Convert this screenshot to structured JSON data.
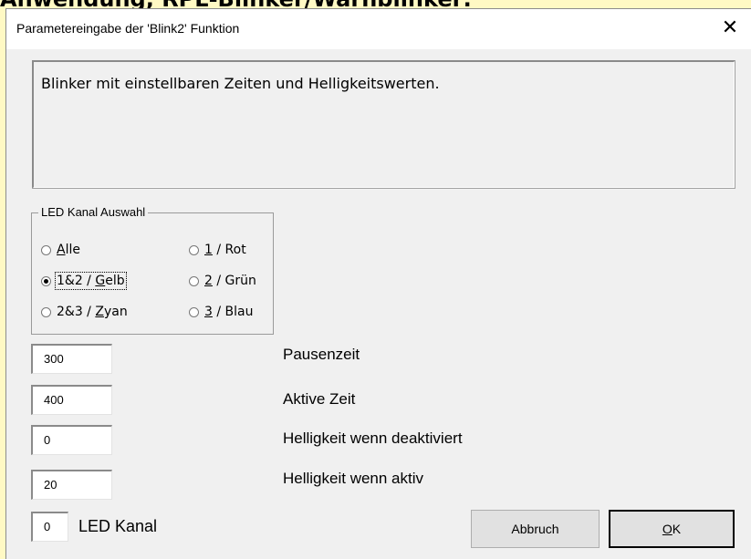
{
  "background_heading": "Anwendung, RPL-Blinker/Warnblinker:",
  "dialog": {
    "title": "Parametereingabe der 'Blink2' Funktion",
    "close_glyph": "✕",
    "description": "Blinker mit einstellbaren Zeiten und Helligkeitswerten."
  },
  "led_group": {
    "label": "LED Kanal Auswahl",
    "options": [
      {
        "mnemonic": "A",
        "rest": "lle",
        "selected": false
      },
      {
        "prefix": "1&2 / ",
        "mnemonic": "G",
        "rest": "elb",
        "selected": true
      },
      {
        "prefix": "2&3 / ",
        "mnemonic": "Z",
        "rest": "yan",
        "selected": false
      },
      {
        "mnemonic": "1",
        "rest": " / Rot",
        "selected": false
      },
      {
        "mnemonic": "2",
        "rest": " / Grün",
        "selected": false
      },
      {
        "mnemonic": "3",
        "rest": " / Blau",
        "selected": false
      }
    ]
  },
  "params": [
    {
      "value": "300",
      "label": "Pausenzeit"
    },
    {
      "value": "400",
      "label": "Aktive Zeit"
    },
    {
      "value": "0",
      "label": "Helligkeit wenn deaktiviert"
    },
    {
      "value": "20",
      "label": "Helligkeit wenn aktiv"
    }
  ],
  "led_kanal": {
    "value": "0",
    "label": "LED Kanal"
  },
  "buttons": {
    "cancel_label": "Abbruch",
    "ok_mnemonic": "O",
    "ok_rest": "K"
  },
  "colors": {
    "page_background": "#fff9c4",
    "dialog_face": "#f0f0f0",
    "titlebar": "#ffffff"
  }
}
